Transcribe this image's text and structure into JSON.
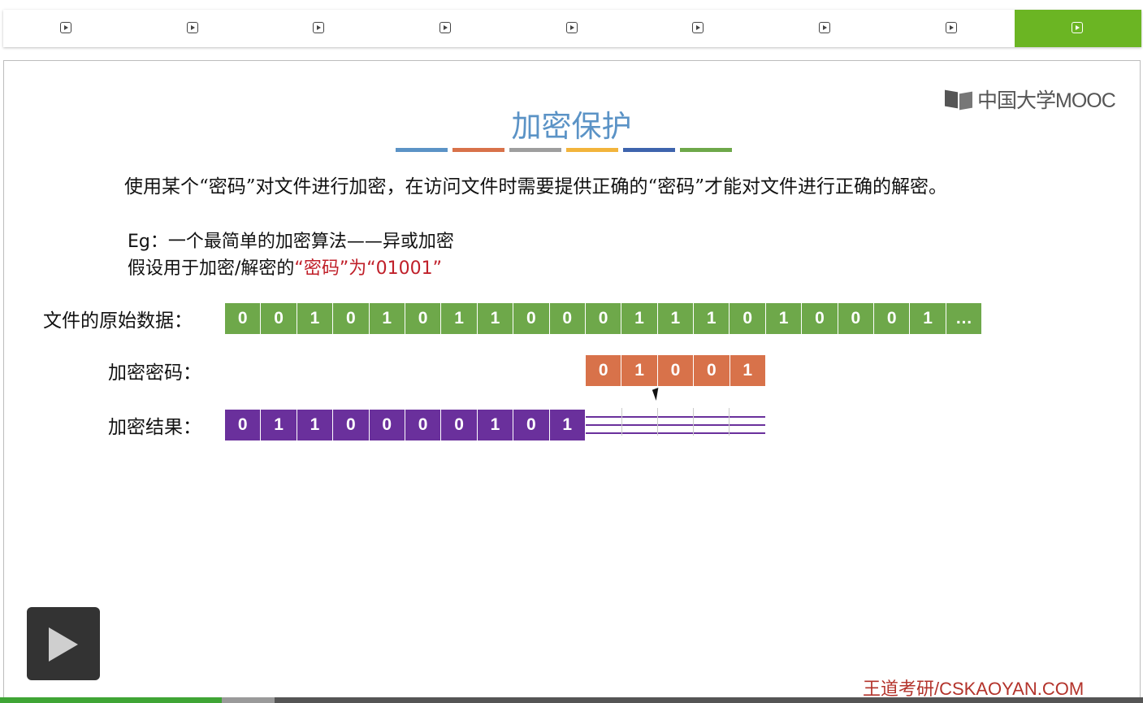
{
  "tabs": {
    "items": [
      {
        "icon": "play-icon"
      },
      {
        "icon": "play-icon"
      },
      {
        "icon": "play-icon"
      },
      {
        "icon": "play-icon"
      },
      {
        "icon": "play-icon"
      },
      {
        "icon": "play-icon"
      },
      {
        "icon": "play-icon"
      },
      {
        "icon": "play-icon"
      },
      {
        "icon": "play-icon",
        "active": true
      }
    ],
    "active_color": "#6bb523"
  },
  "logo": {
    "text": "中国大学MOOC"
  },
  "slide": {
    "title": "加密保护",
    "underline_colors": [
      "#5b93c6",
      "#d8724a",
      "#9e9e9e",
      "#f2b43c",
      "#3e64ad",
      "#6ea84a"
    ],
    "description": "使用某个“密码”对文件进行加密，在访问文件时需要提供正确的“密码”才能对文件进行正确的解密。",
    "example_line1": "Eg：一个最简单的加密算法——异或加密",
    "example_line2_prefix": "假设用于加密/解密的",
    "example_line2_highlight": "“密码”为“01001”",
    "original": {
      "label": "文件的原始数据：",
      "bits": [
        "0",
        "0",
        "1",
        "0",
        "1",
        "0",
        "1",
        "1",
        "0",
        "0",
        "0",
        "1",
        "1",
        "1",
        "0",
        "1",
        "0",
        "0",
        "0",
        "1",
        "…"
      ],
      "color": "#6ea84a"
    },
    "key": {
      "label": "加密密码：",
      "bits": [
        "0",
        "1",
        "0",
        "0",
        "1"
      ],
      "color": "#d8724a"
    },
    "result": {
      "label": "加密结果：",
      "bits": [
        "0",
        "1",
        "1",
        "0",
        "0",
        "0",
        "0",
        "1",
        "0",
        "1"
      ],
      "color": "#6a309c"
    },
    "footer_watermark": "王道考研/CSKAOYAN.COM"
  },
  "player": {
    "play_icon": "play-icon",
    "progress_played": 0.194,
    "progress_buffered": 0.24
  }
}
